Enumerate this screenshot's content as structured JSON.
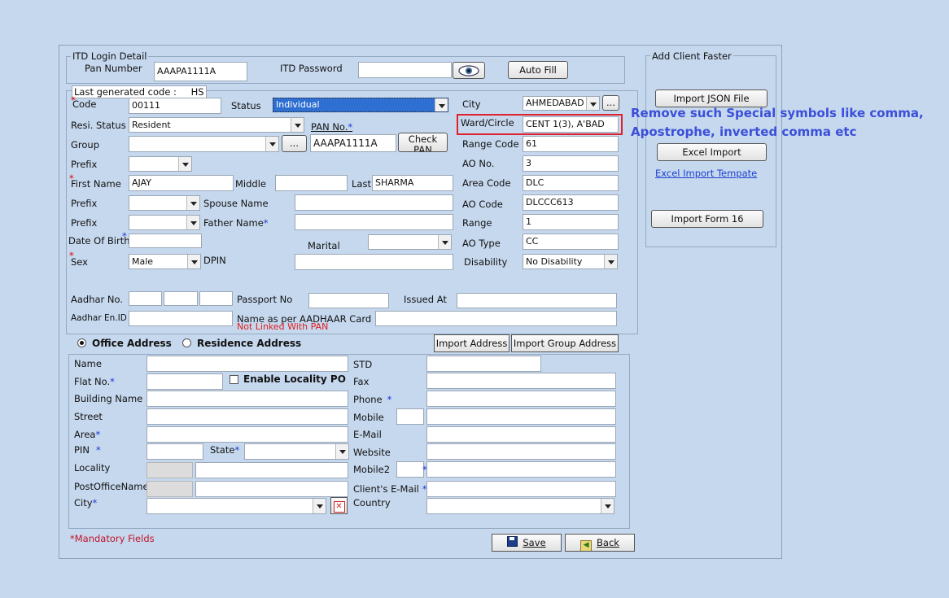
{
  "itd": {
    "legend": "ITD Login Detail",
    "pan_label": "Pan Number",
    "pan_value": "AAAPA1111A",
    "pw_label": "ITD Password",
    "pw_value": "",
    "autofill": "Auto Fill"
  },
  "quick": {
    "legend": "Add Client Faster",
    "import_json": "Import JSON File",
    "excel_import": "Excel Import",
    "excel_template_link": "Excel Import Tempate",
    "import_form16": "Import Form 16"
  },
  "client": {
    "last_code_label": "Last generated code :",
    "last_code_value": "HS",
    "code_label": "Code",
    "code_value": "00111",
    "status_label": "Status",
    "status_value": "Individual",
    "resi_label": "Resi. Status",
    "resi_value": "Resident",
    "panno_label": "PAN No.",
    "group_label": "Group",
    "group_value": "",
    "browse": "...",
    "pan_value": "AAAPA1111A",
    "check_pan": "Check PAN",
    "prefix_label": "Prefix",
    "first_label": "First Name",
    "first_value": "AJAY",
    "middle_label": "Middle",
    "last_label": "Last",
    "last_value": "SHARMA",
    "prefix2_label": "Prefix",
    "spouse_label": "Spouse Name",
    "prefix3_label": "Prefix",
    "father_label": "Father Name",
    "dob_label": "Date Of Birth",
    "marital_label": "Marital",
    "sex_label": "Sex",
    "sex_value": "Male",
    "dpin_label": "DPIN",
    "aadhar_label": "Aadhar No.",
    "passport_label": "Passport No",
    "issued_label": "Issued At",
    "aadhar_en_label": "Aadhar En.ID",
    "name_aadhaar_label": "Name as per AADHAAR Card",
    "not_linked": "Not Linked With PAN",
    "star": "*"
  },
  "ao": {
    "city_label": "City",
    "city_value": "AHMEDABAD",
    "ward_label": "Ward/Circle",
    "ward_value": "CENT 1(3), A'BAD",
    "range_code_label": "Range Code",
    "range_code_value": "61",
    "ao_no_label": "AO No.",
    "ao_no_value": "3",
    "area_code_label": "Area Code",
    "area_code_value": "DLC",
    "ao_code_label": "AO Code",
    "ao_code_value": "DLCCC613",
    "range_label": "Range",
    "range_value": "1",
    "ao_type_label": "AO Type",
    "ao_type_value": "CC",
    "disability_label": "Disability",
    "disability_value": "No Disability"
  },
  "annotation": {
    "line1": "Remove such Special symbols like comma,",
    "line2": "Apostrophe, inverted comma etc",
    "color": "#3b4fd9"
  },
  "address": {
    "office_label": "Office Address",
    "residence_label": "Residence Address",
    "import_address": "Import Address",
    "import_group_address": "Import Group Address",
    "name_label": "Name",
    "flat_label": "Flat No.",
    "locality_po_label": "Enable Locality PO",
    "building_label": "Building Name",
    "street_label": "Street",
    "area_label": "Area",
    "pin_label": "PIN",
    "state_label": "State",
    "locality_label": "Locality",
    "post_office_label": "PostOfficeName",
    "city_label": "City",
    "std_label": "STD",
    "fax_label": "Fax",
    "phone_label": "Phone",
    "mobile_label": "Mobile",
    "email_label": "E-Mail",
    "website_label": "Website",
    "mobile2_label": "Mobile2",
    "client_email_label": "Client's E-Mail",
    "country_label": "Country"
  },
  "footer": {
    "mandatory": "*Mandatory Fields",
    "save": "Save",
    "back": "Back"
  }
}
